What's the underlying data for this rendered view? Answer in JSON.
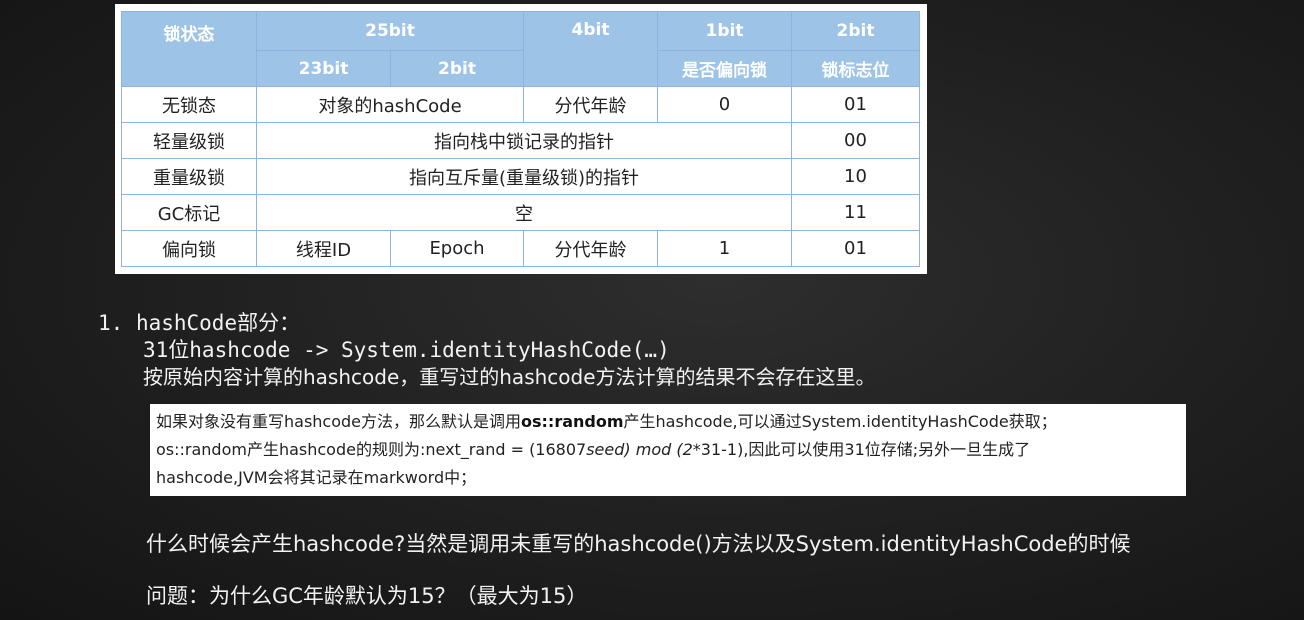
{
  "table": {
    "header_row1": [
      "锁状态",
      "25bit",
      "4bit",
      "1bit",
      "2bit"
    ],
    "header_row2": [
      "23bit",
      "2bit",
      "是否偏向锁",
      "锁标志位"
    ],
    "rows": [
      {
        "state": "无锁态",
        "c1": "对象的hashCode",
        "c2": "分代年龄",
        "c3": "0",
        "c4": "01"
      },
      {
        "state": "轻量级锁",
        "c1": "指向栈中锁记录的指针",
        "c4": "00"
      },
      {
        "state": "重量级锁",
        "c1": "指向互斥量(重量级锁)的指针",
        "c4": "10"
      },
      {
        "state": "GC标记",
        "c1": "空",
        "c4": "11"
      },
      {
        "state": "偏向锁",
        "c1a": "线程ID",
        "c1b": "Epoch",
        "c2": "分代年龄",
        "c3": "1",
        "c4": "01"
      }
    ]
  },
  "section": {
    "number": "1.",
    "title": "hashCode部分：",
    "line1": "31位hashcode -> System.identityHashCode(…)",
    "line2": "按原始内容计算的hashcode，重写过的hashcode方法计算的结果不会存在这里。"
  },
  "note": {
    "line1_pre": "如果对象没有重写hashcode方法，那么默认是调用",
    "line1_bold": "os::random",
    "line1_post": "产生hashcode,可以通过System.identityHashCode获取；",
    "line2_pre": "os::random产生hashcode的规则为:next_rand = (16807",
    "line2_italic": "seed) mod (2",
    "line2_post": "*31-1),因此可以使用31位存储;另外一旦生成了",
    "line3": "hashcode,JVM会将其记录在markword中；"
  },
  "questions": {
    "q1": "什么时候会产生hashcode?当然是调用未重写的hashcode()方法以及System.identityHashCode的时候",
    "q2": "问题：为什么GC年龄默认为15？（最大为15）"
  }
}
